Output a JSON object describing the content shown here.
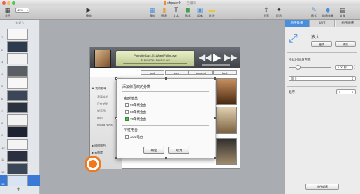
{
  "window": {
    "title": "chpater9",
    "edited_status": "— 已编辑",
    "zoom": "45%"
  },
  "toolbar": {
    "view_label": "显示",
    "play_label": "播放",
    "table_label": "表格",
    "chart_label": "图表",
    "text_label": "文本",
    "shape_label": "形状",
    "media_label": "媒体",
    "comment_label": "批注",
    "share_label": "分享",
    "tips_label": "提示",
    "format_label": "格式",
    "animate_label": "动画效果",
    "document_label": "文稿"
  },
  "navigator": {
    "header": "幻灯片",
    "slide_numbers": [
      "1",
      "2",
      "3",
      "4",
      "5",
      "6",
      "7",
      "8",
      "9",
      "10",
      "11",
      "12",
      "13"
    ],
    "add_label": "+"
  },
  "slide": {
    "song_title": "PortraitInJazz-05-WhenIFallInLove",
    "song_artist": "Bill Evans Trio - Portrait In Jazz",
    "tabs": [
      "local",
      "web",
      "account",
      "feed"
    ],
    "side_menu": {
      "group1": "▼ 我的歌单",
      "items1": [
        "我喜欢的",
        "正在听的",
        "轻音乐",
        "jpop",
        "Bossa Nova"
      ],
      "group2": "▶ 网络电台",
      "group3": "▶ 云曲库"
    }
  },
  "dialog": {
    "title": "添加你喜欢的分类",
    "section1": "实时榜单",
    "options1": [
      {
        "label": "90年代金曲",
        "checked": false
      },
      {
        "label": "80年代金曲",
        "checked": false
      },
      {
        "label": "70年代金曲",
        "checked": true
      }
    ],
    "section2": "个性电台",
    "options2": [
      {
        "label": "Jazz电台",
        "checked": false
      }
    ],
    "ok": "确定",
    "cancel": "取消"
  },
  "inspector": {
    "tabs": [
      "构件效果",
      "动作",
      "构件顺序"
    ],
    "active_tab": 0,
    "effect_name": "放大",
    "change_button": "更改",
    "preview_button": "预览",
    "duration_label": "持续时间与方向",
    "duration_value": "1.00 秒",
    "direction_value": "向上",
    "order_label": "顺序",
    "order_value": "4",
    "build_order_button": "构件顺序",
    "accent_color": "#4a8fde"
  },
  "accents": {
    "record_color": "#f0781d",
    "checkbox_on": "#43b04a"
  }
}
